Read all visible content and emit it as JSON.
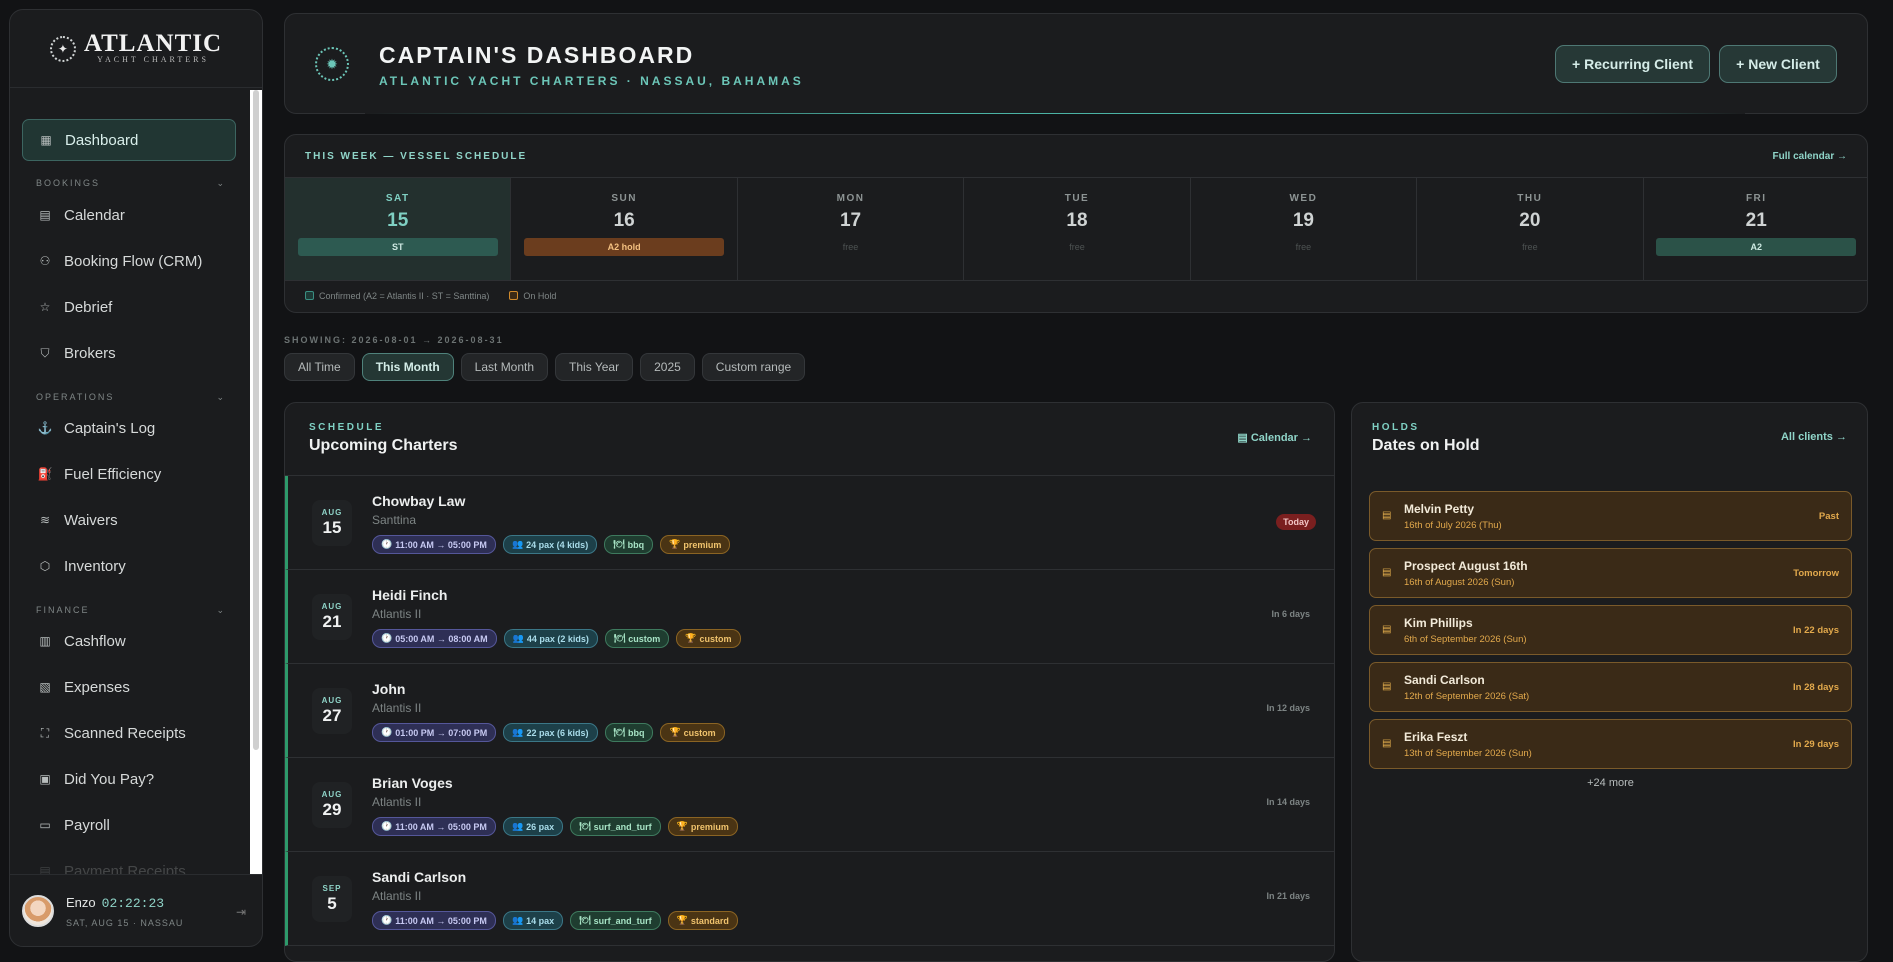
{
  "sidebar": {
    "logo": {
      "main": "ATLANTIC",
      "sub": "YACHT CHARTERS"
    },
    "items": [
      {
        "label": "Dashboard",
        "icon": "grid-icon",
        "glyph": "▦"
      },
      {
        "label": "Calendar",
        "icon": "calendar-icon",
        "glyph": "▤"
      },
      {
        "label": "Booking Flow (CRM)",
        "icon": "users-icon",
        "glyph": "⚇"
      },
      {
        "label": "Debrief",
        "icon": "star-icon",
        "glyph": "☆"
      },
      {
        "label": "Brokers",
        "icon": "handshake-icon",
        "glyph": "⛉"
      },
      {
        "label": "Captain's Log",
        "icon": "anchor-icon",
        "glyph": "⚓"
      },
      {
        "label": "Fuel Efficiency",
        "icon": "fuel-icon",
        "glyph": "⛽"
      },
      {
        "label": "Waivers",
        "icon": "waves-icon",
        "glyph": "≋"
      },
      {
        "label": "Inventory",
        "icon": "box-icon",
        "glyph": "⬡"
      },
      {
        "label": "Cashflow",
        "icon": "bar-chart-icon",
        "glyph": "▥"
      },
      {
        "label": "Expenses",
        "icon": "receipt-icon",
        "glyph": "▧"
      },
      {
        "label": "Scanned Receipts",
        "icon": "scan-icon",
        "glyph": "⛶"
      },
      {
        "label": "Did You Pay?",
        "icon": "clipboard-icon",
        "glyph": "▣"
      },
      {
        "label": "Payroll",
        "icon": "banknote-icon",
        "glyph": "▭"
      },
      {
        "label": "Payment Receipts",
        "icon": "receipt-icon",
        "glyph": "▤"
      }
    ],
    "sections": {
      "bookings": "BOOKINGS",
      "operations": "OPERATIONS",
      "finance": "FINANCE"
    },
    "user": {
      "name": "Enzo",
      "time": "02:22:23",
      "sub": "SAT, AUG 15 · NASSAU"
    }
  },
  "header": {
    "title": "CAPTAIN'S DASHBOARD",
    "subtitle": "ATLANTIC YACHT CHARTERS · NASSAU, BAHAMAS",
    "recurring_label": "+ Recurring Client",
    "new_label": "+ New Client"
  },
  "week": {
    "title": "THIS WEEK — VESSEL SCHEDULE",
    "link": "Full calendar →",
    "days": [
      {
        "name": "SAT",
        "num": "15",
        "badge": "ST",
        "kind": "st",
        "today": true
      },
      {
        "name": "SUN",
        "num": "16",
        "badge": "A2 hold",
        "kind": "hold"
      },
      {
        "name": "MON",
        "num": "17",
        "free": "free"
      },
      {
        "name": "TUE",
        "num": "18",
        "free": "free"
      },
      {
        "name": "WED",
        "num": "19",
        "free": "free"
      },
      {
        "name": "THU",
        "num": "20",
        "free": "free"
      },
      {
        "name": "FRI",
        "num": "21",
        "badge": "A2",
        "kind": "a2"
      }
    ],
    "legend": {
      "confirmed": "Confirmed (A2 = Atlantis II · ST = Santtina)",
      "hold": "On Hold"
    },
    "colors": {
      "confirmed": "#3a8f82",
      "hold": "#d08a2c"
    }
  },
  "filters": {
    "showing": "SHOWING: 2026-08-01 → 2026-08-31",
    "options": [
      "All Time",
      "This Month",
      "Last Month",
      "This Year",
      "2025",
      "Custom range"
    ],
    "active": "This Month"
  },
  "schedule": {
    "label": "SCHEDULE",
    "title": "Upcoming Charters",
    "link": "Calendar →",
    "rows": [
      {
        "mon": "AUG",
        "day": "15",
        "name": "Chowbay Law",
        "vessel": "Santtina",
        "time": "11:00 AM → 05:00 PM",
        "pax": "24 pax (4 kids)",
        "food": "bbq",
        "pkg": "premium",
        "status": "Today"
      },
      {
        "mon": "AUG",
        "day": "21",
        "name": "Heidi Finch",
        "vessel": "Atlantis II",
        "time": "05:00 AM → 08:00 AM",
        "pax": "44 pax (2 kids)",
        "food": "custom",
        "pkg": "custom",
        "status": "In 6 days"
      },
      {
        "mon": "AUG",
        "day": "27",
        "name": "John",
        "vessel": "Atlantis II",
        "time": "01:00 PM → 07:00 PM",
        "pax": "22 pax (6 kids)",
        "food": "bbq",
        "pkg": "custom",
        "status": "In 12 days"
      },
      {
        "mon": "AUG",
        "day": "29",
        "name": "Brian Voges",
        "vessel": "Atlantis II",
        "time": "11:00 AM → 05:00 PM",
        "pax": "26 pax",
        "food": "surf_and_turf",
        "pkg": "premium",
        "status": "In 14 days"
      },
      {
        "mon": "SEP",
        "day": "5",
        "name": "Sandi Carlson",
        "vessel": "Atlantis II",
        "time": "11:00 AM → 05:00 PM",
        "pax": "14 pax",
        "food": "surf_and_turf",
        "pkg": "standard",
        "status": "In 21 days"
      }
    ]
  },
  "holds": {
    "label": "HOLDS",
    "title": "Dates on Hold",
    "link": "All clients →",
    "items": [
      {
        "name": "Melvin Petty",
        "date": "16th of July 2026 (Thu)",
        "rel": "Past"
      },
      {
        "name": "Prospect August 16th",
        "date": "16th of August 2026 (Sun)",
        "rel": "Tomorrow"
      },
      {
        "name": "Kim Phillips",
        "date": "6th of September 2026 (Sun)",
        "rel": "In 22 days"
      },
      {
        "name": "Sandi Carlson",
        "date": "12th of September 2026 (Sat)",
        "rel": "In 28 days"
      },
      {
        "name": "Erika Feszt",
        "date": "13th of September 2026 (Sun)",
        "rel": "In 29 days"
      }
    ],
    "more": "+24 more"
  }
}
